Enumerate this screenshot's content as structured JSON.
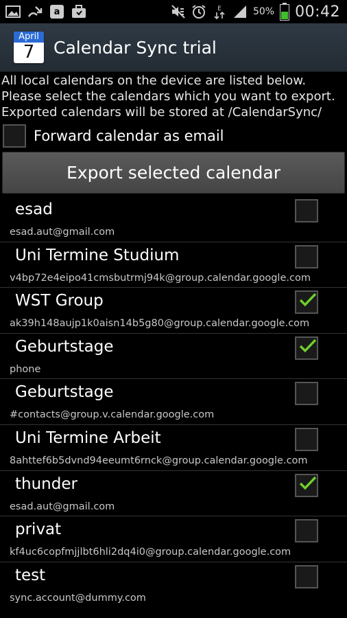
{
  "status_bar": {
    "battery_percent": "50%",
    "time": "00:42",
    "icons": [
      "gallery-icon",
      "missed-call-icon",
      "amazon-icon",
      "briefcase-icon",
      "mute-icon",
      "alarm-icon",
      "data-arrows-icon",
      "signal-icon",
      "battery-icon"
    ]
  },
  "action_bar": {
    "icon_month": "April",
    "icon_day": "7",
    "title": "Calendar Sync trial"
  },
  "intro_text": "All local calendars on the device are listed below. Please select the calendars which you want to export. Exported calendars will be stored at /CalendarSync/",
  "forward_option": {
    "label": "Forward calendar as email",
    "checked": false
  },
  "export_button": "Export selected calendar",
  "calendars": [
    {
      "name": "esad",
      "account": "esad.aut@gmail.com",
      "checked": false
    },
    {
      "name": "Uni Termine Studium",
      "account": "v4bp72e4eipo41cmsbutrmj94k@group.calendar.google.com",
      "checked": false
    },
    {
      "name": "WST Group",
      "account": "ak39h148aujp1k0aisn14b5g80@group.calendar.google.com",
      "checked": true
    },
    {
      "name": "Geburtstage",
      "account": "phone",
      "checked": true
    },
    {
      "name": "Geburtstage",
      "account": "#contacts@group.v.calendar.google.com",
      "checked": false
    },
    {
      "name": "Uni Termine Arbeit",
      "account": "8ahttef6b5dvnd94eeumt6rnck@group.calendar.google.com",
      "checked": false
    },
    {
      "name": "thunder",
      "account": "esad.aut@gmail.com",
      "checked": true
    },
    {
      "name": "privat",
      "account": "kf4uc6copfmjjlbt6hli2dq4i0@group.calendar.google.com",
      "checked": false
    },
    {
      "name": "test",
      "account": "sync.account@dummy.com",
      "checked": false
    }
  ],
  "colors": {
    "check_green": "#6fd12a",
    "action_bar": "#2a333c",
    "battery_green": "#3fbf2a"
  }
}
